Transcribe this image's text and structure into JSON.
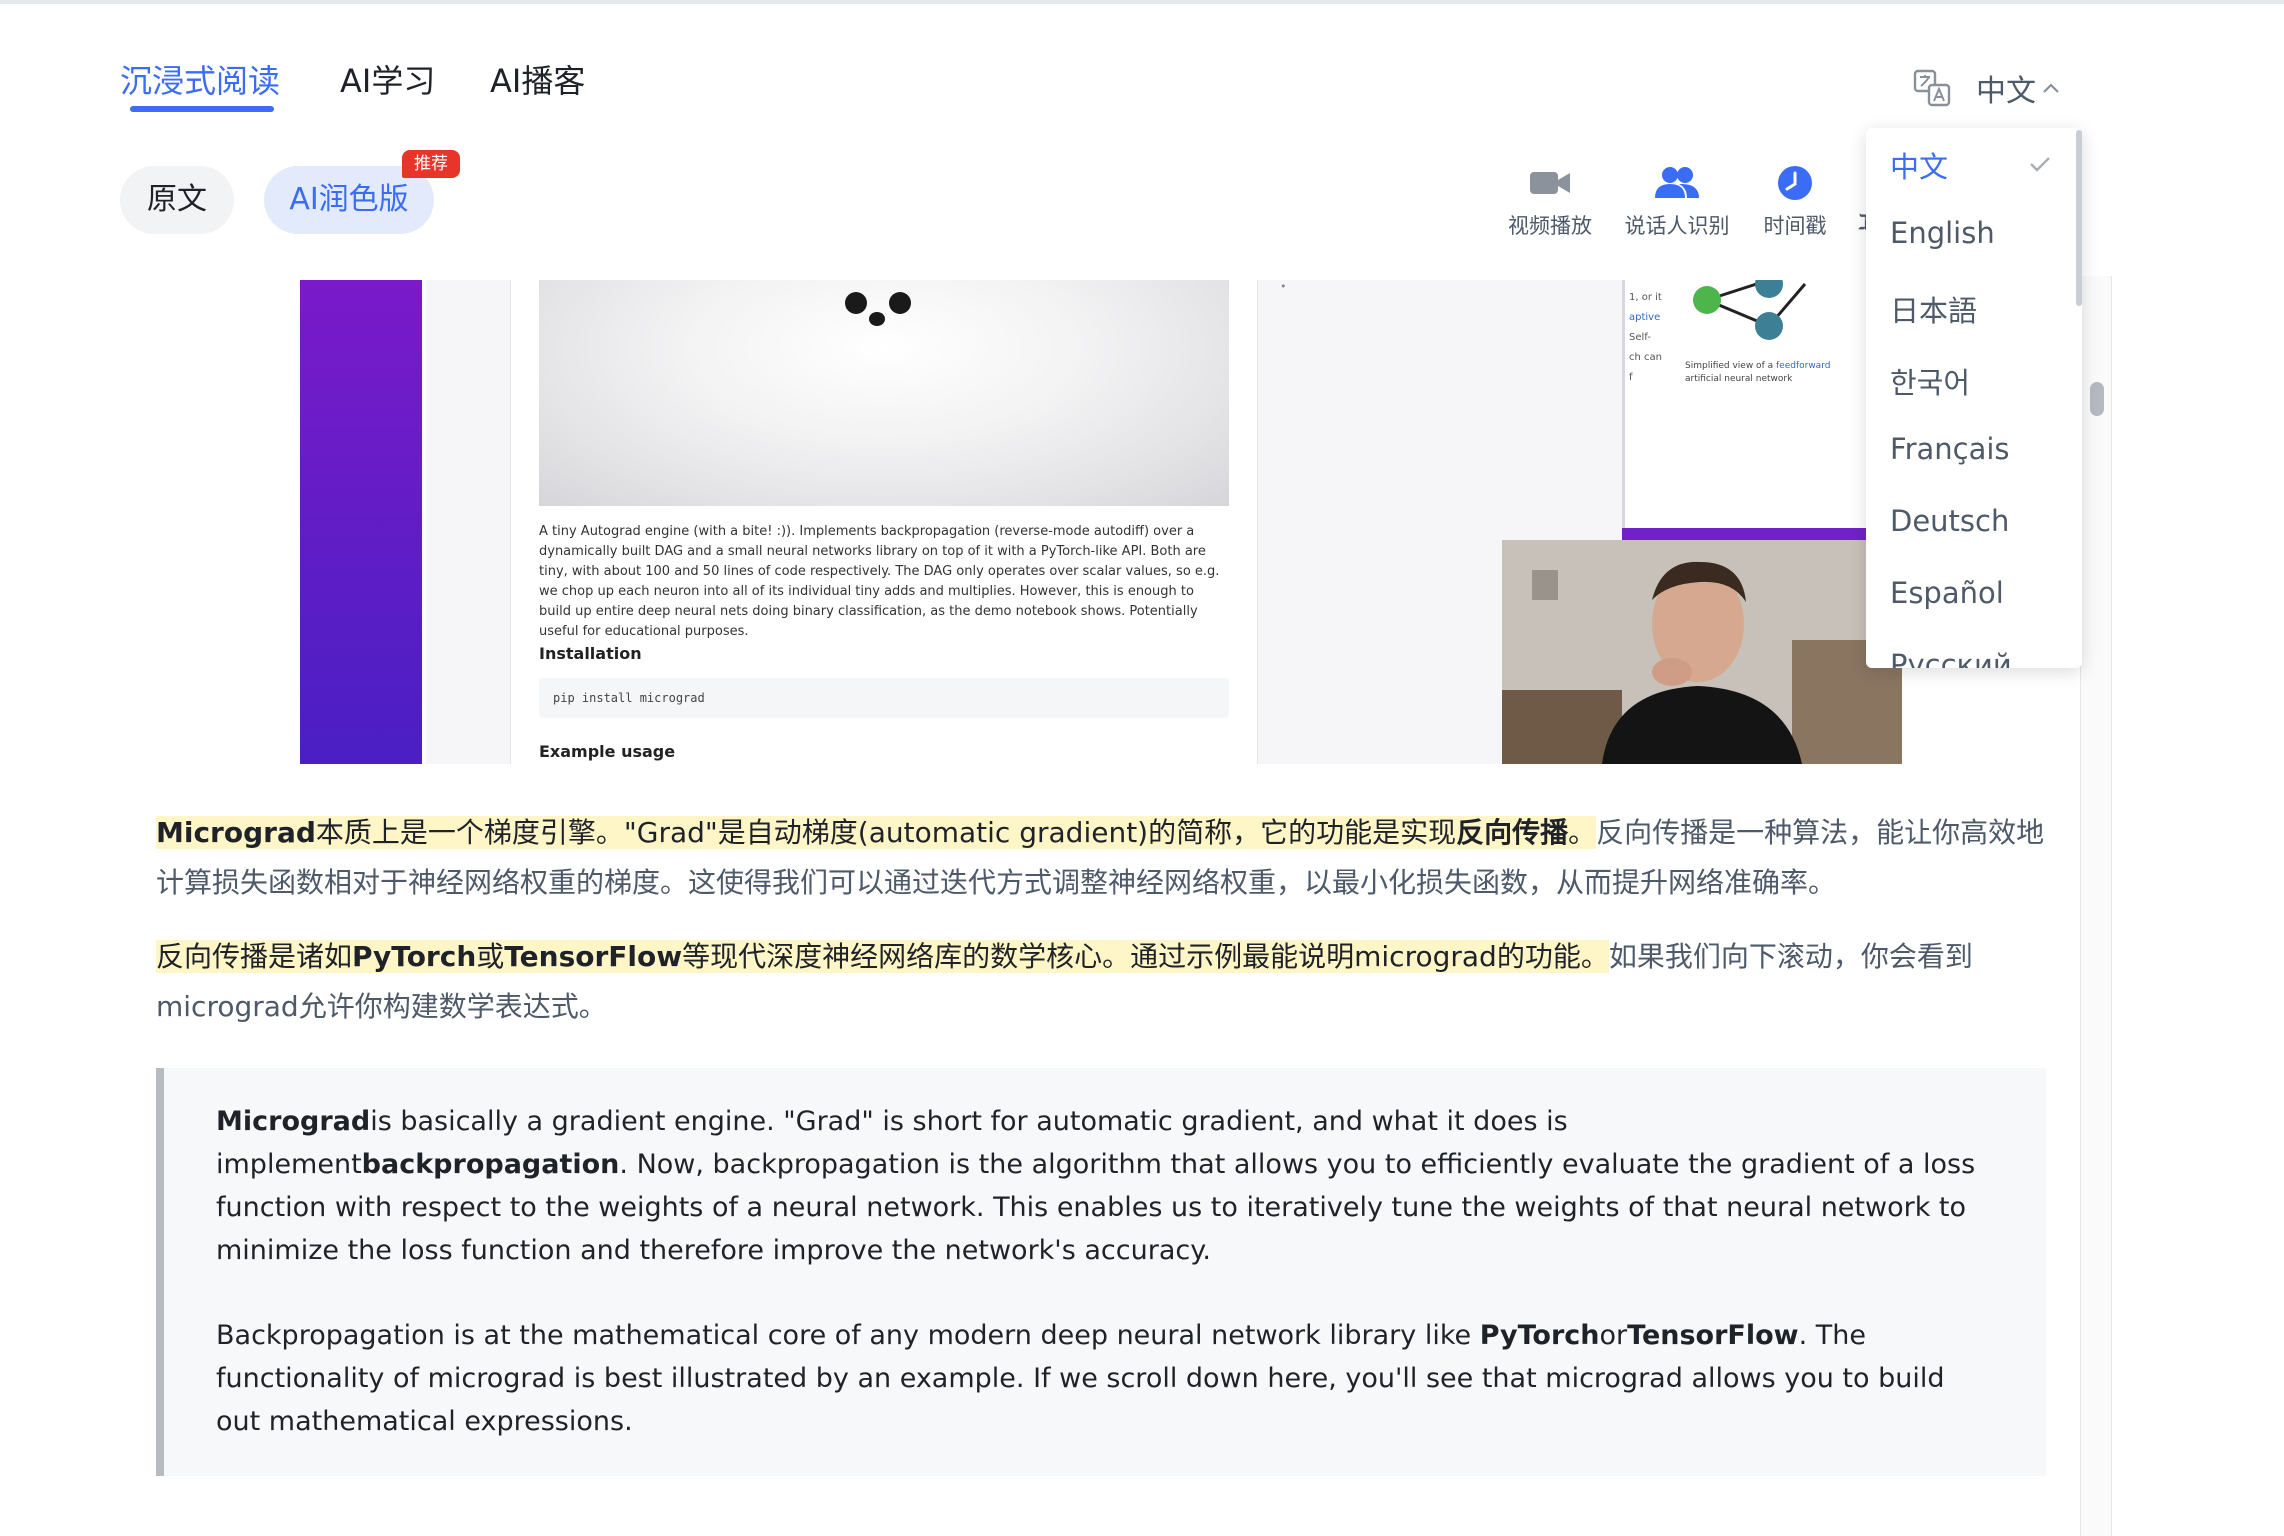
{
  "tabs": [
    {
      "label": "沉浸式阅读",
      "active": true
    },
    {
      "label": "AI学习",
      "active": false
    },
    {
      "label": "AI播客",
      "active": false
    }
  ],
  "language": {
    "current": "中文",
    "options": [
      "中文",
      "English",
      "日本語",
      "한국어",
      "Français",
      "Deutsch",
      "Español",
      "Русский"
    ],
    "selected_index": 0
  },
  "versions": {
    "original": "原文",
    "ai": "AI润色版",
    "ai_badge": "推荐"
  },
  "toolbar": [
    {
      "label": "视频播放",
      "icon": "video-camera-icon"
    },
    {
      "label": "说话人识别",
      "icon": "people-icon"
    },
    {
      "label": "时间戳",
      "icon": "clock-icon"
    },
    {
      "label": "ℷ",
      "icon": "partial-icon"
    }
  ],
  "video_frame": {
    "description_text": "A tiny Autograd engine (with a bite! :)). Implements backpropagation (reverse-mode autodiff) over a dynamically built DAG and a small neural networks library on top of it with a PyTorch-like API. Both are tiny, with about 100 and 50 lines of code respectively. The DAG only operates over scalar values, so e.g. we chop up each neuron into all of its individual tiny adds and multiplies. However, this is enough to build up entire deep neural nets doing binary classification, as the demo notebook shows. Potentially useful for educational purposes.",
    "installation_heading": "Installation",
    "install_command": "pip install micrograd",
    "example_heading": "Example usage",
    "wiki_caption_prefix": "Simplified view of a ",
    "wiki_caption_link": "feedforward",
    "wiki_caption_suffix": " artificial neural network",
    "wiki_side_lines": [
      "1, or it",
      "",
      "aptive",
      "Self-",
      "ch can",
      "f"
    ]
  },
  "chinese": {
    "p1": {
      "s1_bold": "Micrograd",
      "s1_a": "本质上是一个梯度引擎。\"Grad\"是自动梯度(automatic gradient)的简称，它的功能是实现",
      "s1_bold2": "反向传播",
      "s1_end": "。",
      "rest": "反向传播是一种算法，能让你高效地计算损失函数相对于神经网络权重的梯度。这使得我们可以通过迭代方式调整神经网络权重，以最小化损失函数，从而提升网络准确率。"
    },
    "p2": {
      "a": "反向传播是诸如",
      "b1": "PyTorch",
      "c": "或",
      "b2": "TensorFlow",
      "d": "等现代深度神经网络库的数学核心。通过示例最能说明micrograd的功能。",
      "rest": "如果我们向下滚动，你会看到micrograd允许你构建数学表达式。"
    }
  },
  "english": {
    "p1": {
      "b1": "Micrograd",
      "a": "is basically a gradient engine. \"Grad\" is short for automatic gradient, and what it does is implement",
      "b2": "backpropagation",
      "rest": ". Now, backpropagation is the algorithm that allows you to efficiently evaluate the gradient of a loss function with respect to the weights of a neural network. This enables us to iteratively tune the weights of that neural network to minimize the loss function and therefore improve the network's accuracy."
    },
    "p2": {
      "a": "Backpropagation is at the mathematical core of any modern deep neural network library like ",
      "b1": "PyTorch",
      "c": "or",
      "b2": "TensorFlow",
      "rest": ". The functionality of micrograd is best illustrated by an example. If we scroll down here, you'll see that micrograd allows you to build out mathematical expressions."
    }
  },
  "colors": {
    "accent": "#3b6cf6",
    "highlight": "#fff6c7",
    "badge": "#e8352a"
  }
}
